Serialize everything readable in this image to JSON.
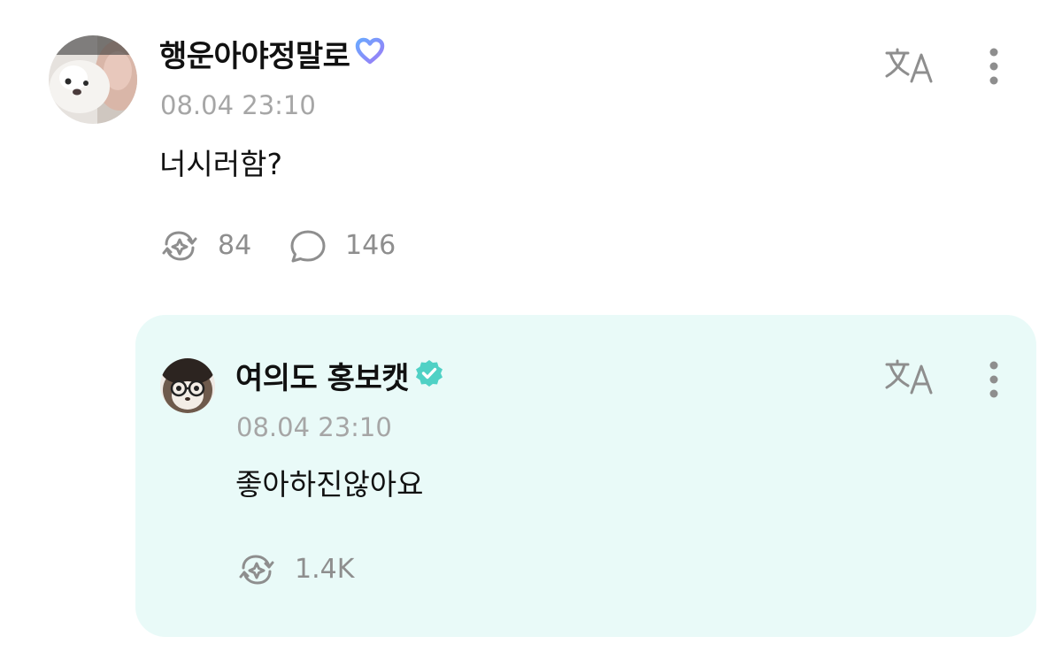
{
  "post": {
    "username": "행운아야정말로",
    "badge_icon": "heart-outline-badge-icon",
    "timestamp": "08.04 23:10",
    "content": "너시러함?",
    "remix_count": "84",
    "reply_count": "146",
    "translate_icon": "translate-icon",
    "more_icon": "more-vertical-icon"
  },
  "reply": {
    "username": "여의도 홍보캣",
    "badge_icon": "verified-check-badge-icon",
    "timestamp": "08.04 23:10",
    "content": "좋아하진않아요",
    "remix_count": "1.4K",
    "translate_icon": "translate-icon",
    "more_icon": "more-vertical-icon"
  },
  "colors": {
    "reply_background": "#e9faf8",
    "heart_badge": "#8b7cf6",
    "verified_badge": "#4fd1c5",
    "muted_text": "#a6a6a6"
  }
}
